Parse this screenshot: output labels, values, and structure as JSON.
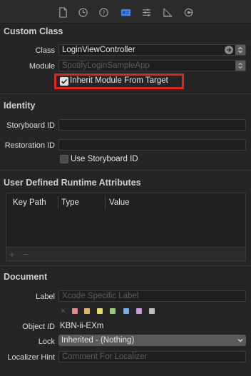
{
  "toolbar": {
    "icons": [
      "file-inspector-icon",
      "history-inspector-icon",
      "quick-help-icon",
      "identity-inspector-icon",
      "attributes-inspector-icon",
      "size-inspector-icon",
      "connections-inspector-icon"
    ]
  },
  "custom_class": {
    "header": "Custom Class",
    "class_label": "Class",
    "class_value": "LoginViewController",
    "module_label": "Module",
    "module_placeholder": "SpotifyLoginSampleApp",
    "inherit_label": "Inherit Module From Target",
    "inherit_checked": true
  },
  "identity": {
    "header": "Identity",
    "storyboard_id_label": "Storyboard ID",
    "storyboard_id_value": "",
    "restoration_id_label": "Restoration ID",
    "restoration_id_value": "",
    "use_storyboard_id_label": "Use Storyboard ID",
    "use_storyboard_id_checked": false
  },
  "runtime_attributes": {
    "header": "User Defined Runtime Attributes",
    "columns": [
      "Key Path",
      "Type",
      "Value"
    ],
    "add_label": "+",
    "remove_label": "−"
  },
  "document": {
    "header": "Document",
    "label_label": "Label",
    "label_placeholder": "Xcode Specific Label",
    "clear_label": "×",
    "colors": [
      "#e08a8a",
      "#e8b266",
      "#e6dc6a",
      "#8fcf7b",
      "#6fb4e8",
      "#c99ae0",
      "#bdbdbd"
    ],
    "object_id_label": "Object ID",
    "object_id_value": "KBN-ii-EXm",
    "lock_label": "Lock",
    "lock_value": "Inherited - (Nothing)",
    "localizer_label": "Localizer Hint",
    "localizer_placeholder": "Comment For Localizer"
  }
}
